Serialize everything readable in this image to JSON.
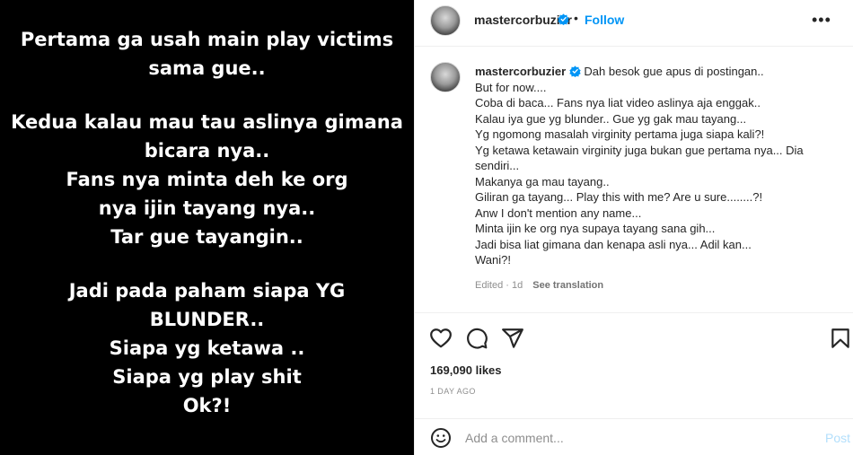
{
  "image_text": {
    "lines": [
      "Pertama ga usah main play victims",
      "sama gue..",
      "",
      "Kedua kalau mau tau aslinya gimana",
      "bicara nya..",
      "Fans nya minta deh ke org",
      "nya ijin tayang nya..",
      "Tar gue tayangin..",
      "",
      "Jadi pada paham siapa YG",
      "BLUNDER..",
      "Siapa yg ketawa ..",
      "Siapa yg play shit",
      "Ok?!"
    ]
  },
  "header": {
    "username": "mastercorbuzier",
    "separator": "•",
    "follow_label": "Follow",
    "more_label": "•••"
  },
  "caption": {
    "username": "mastercorbuzier",
    "lines": [
      "Dah besok gue apus di postingan..",
      "But for now....",
      "Coba di baca... Fans nya liat video aslinya aja enggak..",
      "Kalau iya gue yg blunder.. Gue yg gak mau tayang...",
      "Yg ngomong masalah virginity pertama juga siapa kali?!",
      "Yg ketawa ketawain virginity juga bukan gue pertama nya... Dia",
      "sendiri...",
      "Makanya ga mau tayang..",
      "Giliran ga tayang... Play this with me? Are u sure........?!",
      "Anw I don't mention any name...",
      "Minta ijin ke org nya supaya tayang sana gih...",
      "Jadi bisa liat gimana dan kenapa asli nya... Adil kan...",
      "Wani?!"
    ],
    "meta": "Edited · 1d",
    "see_translation": "See translation"
  },
  "actions": {
    "icons": [
      "heart-icon",
      "comment-icon",
      "share-icon",
      "bookmark-icon"
    ]
  },
  "likes": "169,090 likes",
  "time": "1 DAY AGO",
  "comment_box": {
    "placeholder": "Add a comment...",
    "post_label": "Post"
  },
  "colors": {
    "accent": "#0095f6",
    "post_disabled": "#b2dffc",
    "verified": "#0095f6"
  }
}
